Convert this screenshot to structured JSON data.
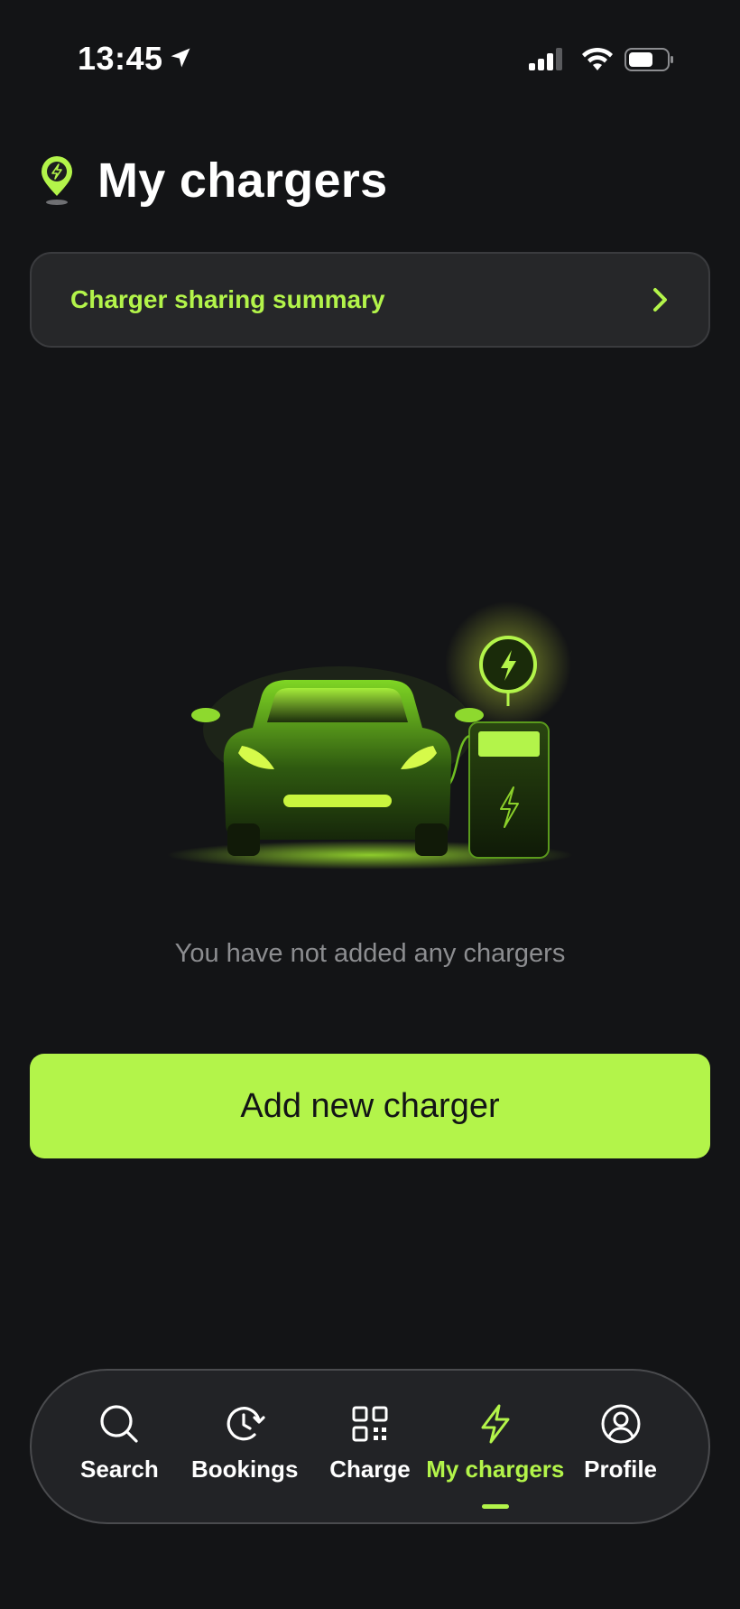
{
  "status_bar": {
    "time": "13:45",
    "icons": [
      "location-arrow-icon",
      "signal-icon",
      "wifi-icon",
      "battery-icon"
    ]
  },
  "header": {
    "title": "My chargers",
    "icon": "charger-pin-icon"
  },
  "summary_card": {
    "label": "Charger sharing summary",
    "icon": "chevron-right-icon"
  },
  "empty_state": {
    "illustration": "car-charging-illustration",
    "message": "You have not added any chargers"
  },
  "primary_action": {
    "label": "Add new charger"
  },
  "bottom_nav": {
    "items": [
      {
        "label": "Search",
        "icon": "search-icon",
        "active": false
      },
      {
        "label": "Bookings",
        "icon": "clock-icon",
        "active": false
      },
      {
        "label": "Charge",
        "icon": "qr-code-icon",
        "active": false
      },
      {
        "label": "My chargers",
        "icon": "lightning-icon",
        "active": true
      },
      {
        "label": "Profile",
        "icon": "user-icon",
        "active": false
      }
    ]
  },
  "colors": {
    "background": "#131416",
    "accent": "#b3f44a",
    "card": "#262729",
    "muted_text": "#8c8d90"
  }
}
